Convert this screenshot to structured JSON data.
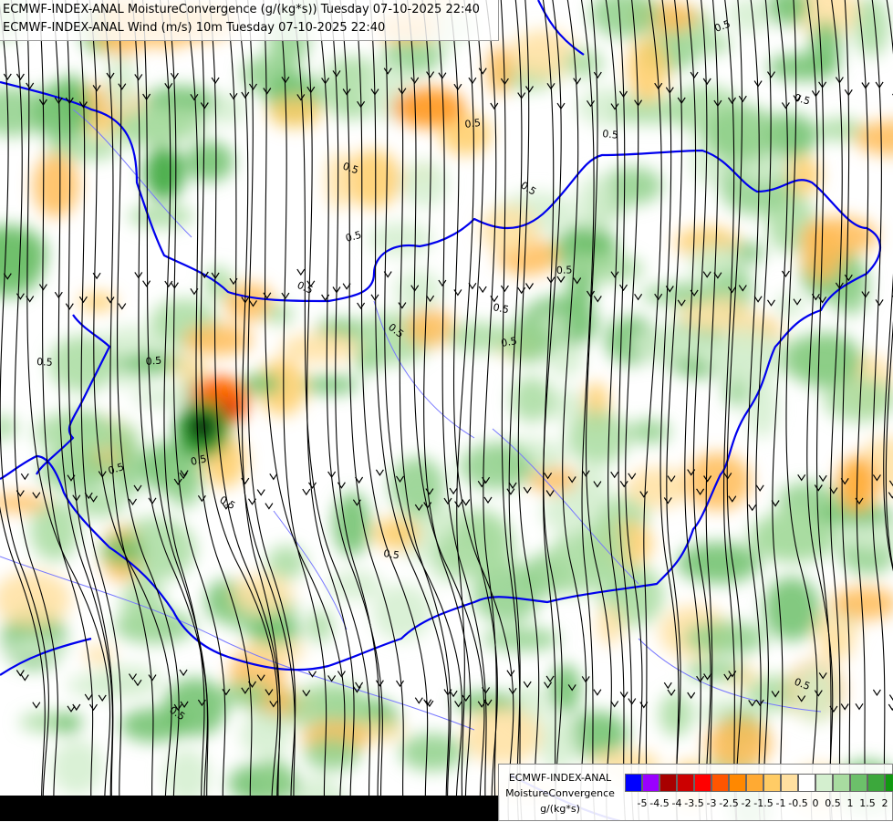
{
  "title": {
    "line1": "ECMWF-INDEX-ANAL MoistureConvergence (g/(kg*s)) Tuesday 07-10-2025 22:40",
    "line2": "ECMWF-INDEX-ANAL Wind (m/s) 10m Tuesday 07-10-2025 22:40"
  },
  "contour_labels": [
    "0.5",
    "0.5",
    "0.5",
    "0.5",
    "0.5",
    "0.5",
    "0.5",
    "0.5",
    "0.5",
    "0.5",
    "0.5",
    "0.5",
    "0.5",
    "0.5",
    "0.5",
    "0.5",
    "0.5",
    "0.5",
    "0.5",
    "0.5"
  ],
  "legend": {
    "model": "ECMWF-INDEX-ANAL",
    "parameter": "MoistureConvergence",
    "unit": "g/(kg*s)",
    "swatch_colors": [
      "#0000ff",
      "#9a00ff",
      "#a80000",
      "#cc0000",
      "#ff0000",
      "#ff5500",
      "#ff8800",
      "#ffaa33",
      "#ffcc66",
      "#ffe0a0",
      "#ffffff",
      "#d4efcf",
      "#a8dca0",
      "#6cc06a",
      "#3ca83c",
      "#119911"
    ],
    "ticks": [
      "-5",
      "-4.5",
      "-4",
      "-3.5",
      "-3",
      "-2.5",
      "-2",
      "-1.5",
      "-1",
      "-0.5",
      "0",
      "0.5",
      "1",
      "1.5",
      "2"
    ]
  },
  "colors": {
    "border": "#0000ee",
    "river": "#7777ff",
    "streamline": "#000000",
    "convergence_pos": "#6cc06a",
    "convergence_neg": "#ffaa33"
  }
}
